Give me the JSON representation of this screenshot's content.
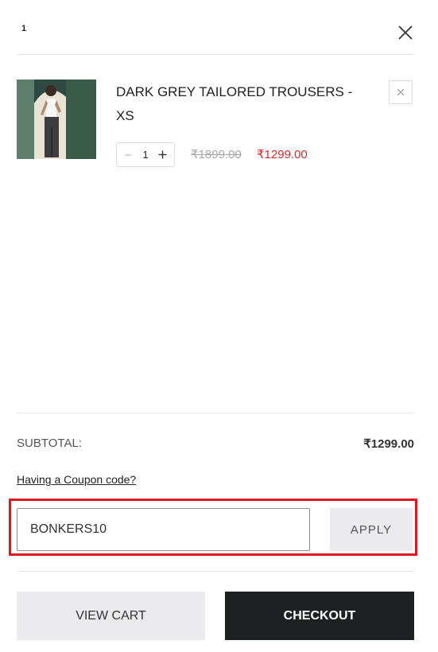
{
  "header": {
    "item_count": "1",
    "close_icon": "close-icon"
  },
  "item": {
    "title": "DARK GREY TAILORED TROUSERS - XS",
    "quantity": "1",
    "original_price": "₹1899.00",
    "sale_price": "₹1299.00",
    "image_icon": "product-image"
  },
  "summary": {
    "subtotal_label": "SUBTOTAL:",
    "subtotal_value": "₹1299.00",
    "coupon_link": "Having a Coupon code?"
  },
  "coupon": {
    "value": "BONKERS10",
    "apply_label": "APPLY"
  },
  "actions": {
    "view_cart": "VIEW CART",
    "checkout": "CHECKOUT"
  },
  "colors": {
    "sale_price": "#d62b2b",
    "highlight": "#e0161e",
    "checkout_bg": "#1e2124",
    "secondary_bg": "#ebebee"
  }
}
